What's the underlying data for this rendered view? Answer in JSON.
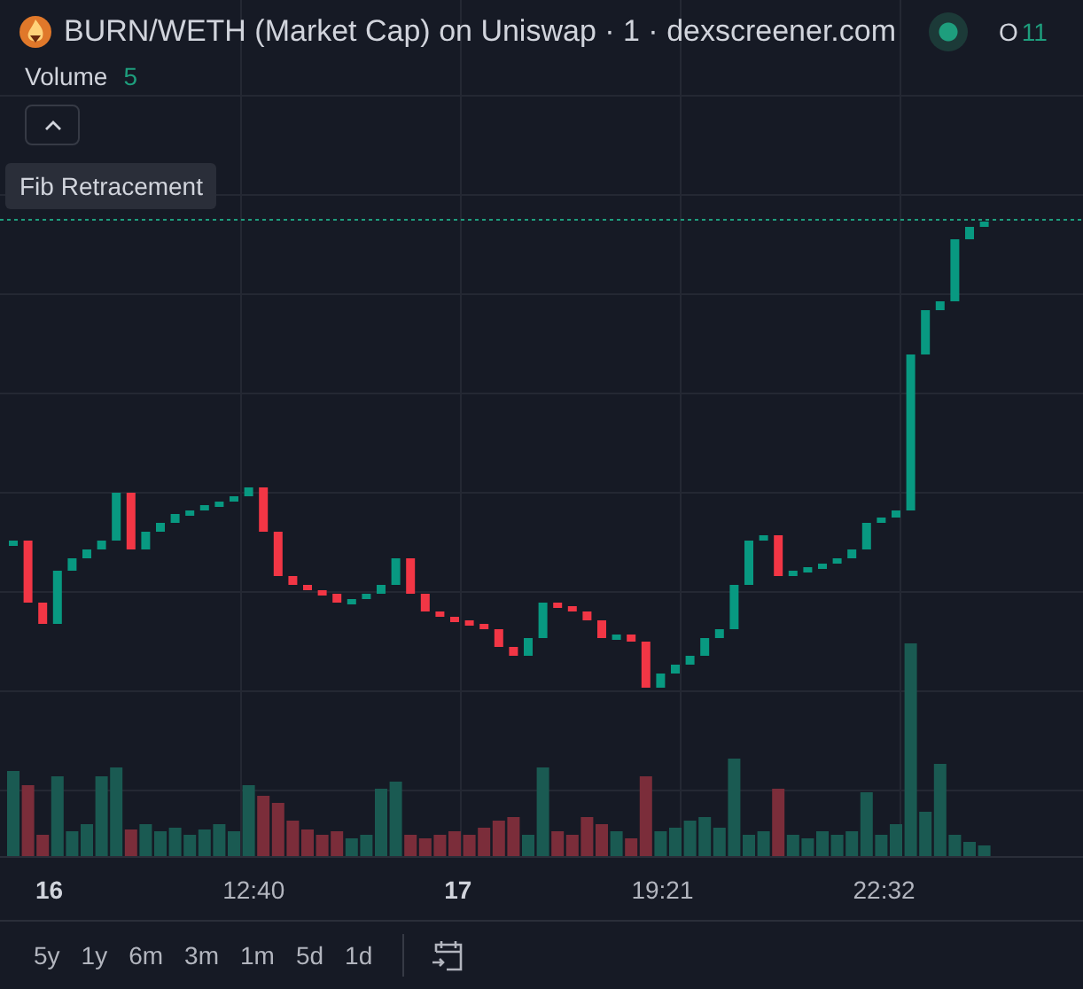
{
  "header": {
    "title": "BURN/WETH (Market Cap) on Uniswap · 1 · dexscreener.com",
    "live": true,
    "ohlc_label": "O",
    "ohlc_value": "11"
  },
  "volume": {
    "label": "Volume",
    "value": "5"
  },
  "tooltip": "Fib Retracement",
  "x_axis": [
    {
      "label": "16",
      "bold": true
    },
    {
      "label": "12:40",
      "bold": false
    },
    {
      "label": "17",
      "bold": true
    },
    {
      "label": "19:21",
      "bold": false
    },
    {
      "label": "22:32",
      "bold": false
    }
  ],
  "ranges": [
    "5y",
    "1y",
    "6m",
    "3m",
    "1m",
    "5d",
    "1d"
  ]
}
